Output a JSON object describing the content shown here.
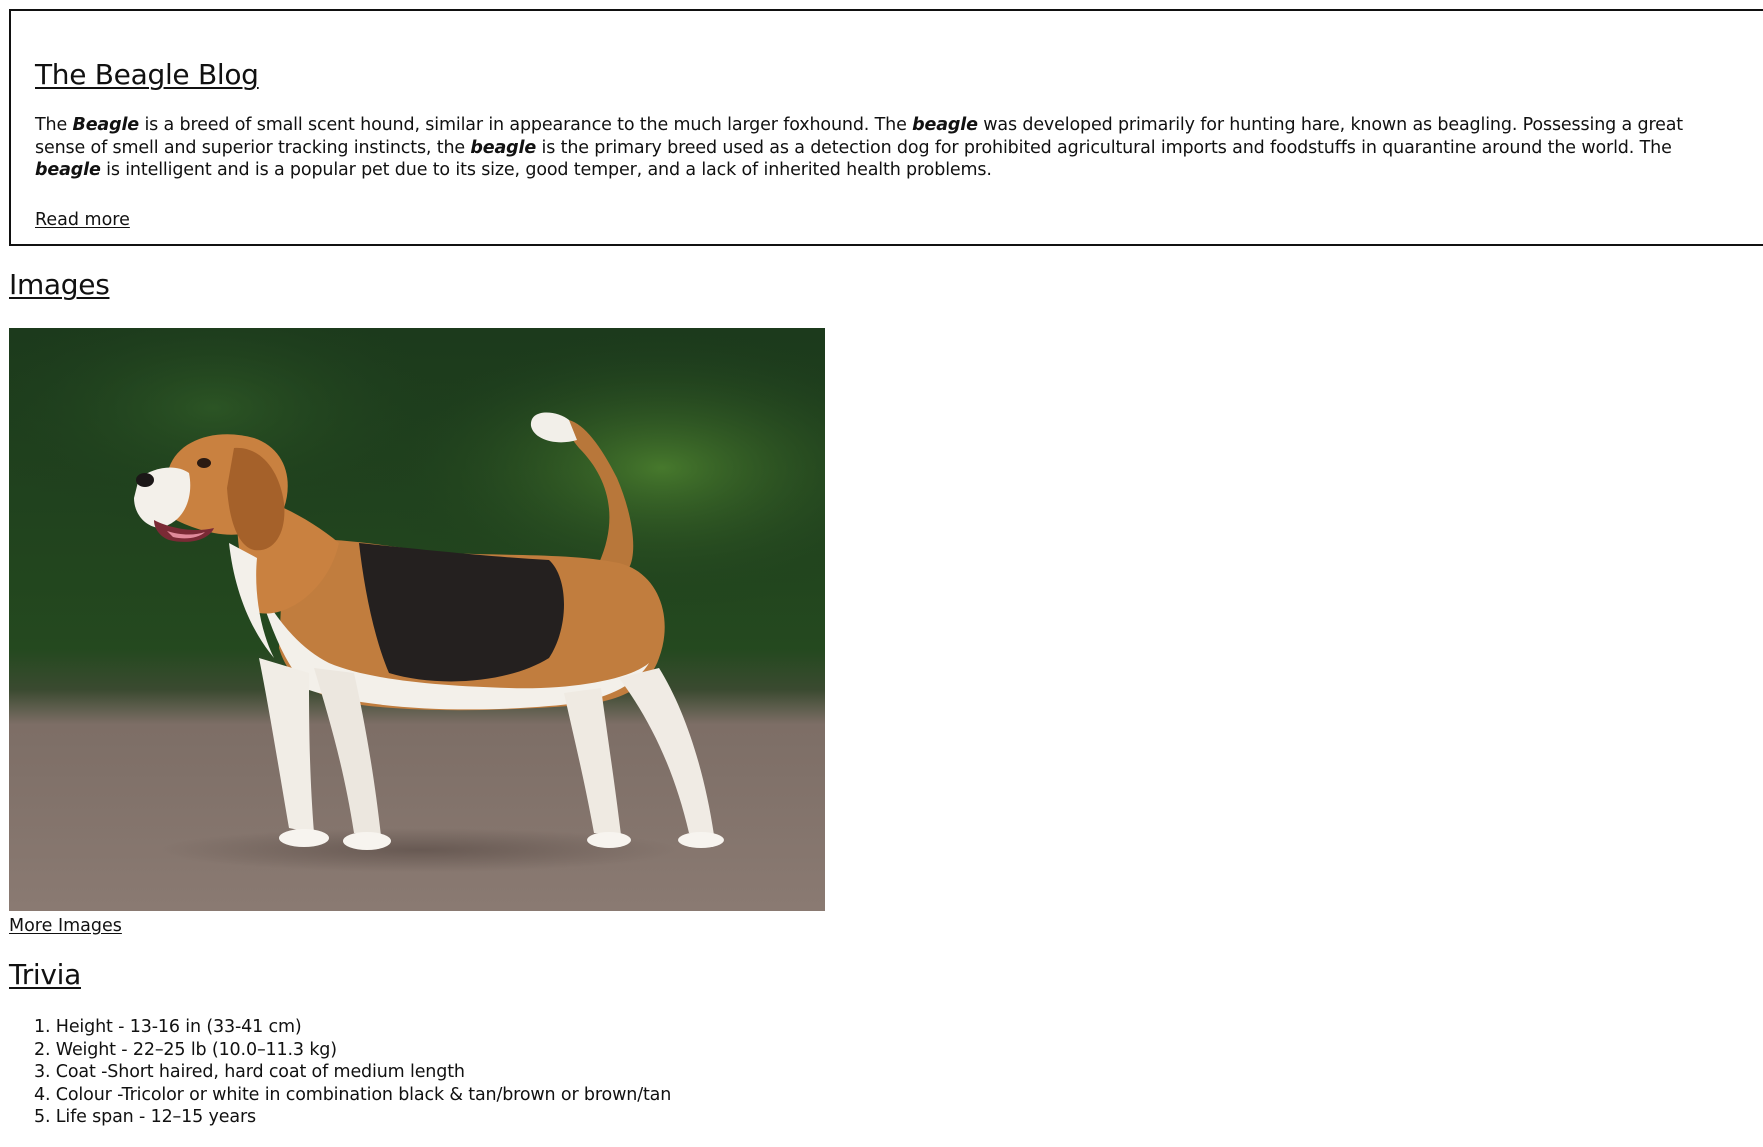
{
  "blog": {
    "title": "The Beagle Blog",
    "intro": [
      {
        "text": "The ",
        "emphasis": false
      },
      {
        "text": "Beagle",
        "emphasis": true
      },
      {
        "text": " is a breed of small scent hound, similar in appearance to the much larger foxhound. The ",
        "emphasis": false
      },
      {
        "text": "beagle",
        "emphasis": true
      },
      {
        "text": " was developed primarily for hunting hare, known as beagling. Possessing a great sense of smell and superior tracking instincts, the ",
        "emphasis": false
      },
      {
        "text": "beagle",
        "emphasis": true
      },
      {
        "text": " is the primary breed used as a detection dog for prohibited agricultural imports and foodstuffs in quarantine around the world. The ",
        "emphasis": false
      },
      {
        "text": "beagle",
        "emphasis": true
      },
      {
        "text": " is intelligent and is a popular pet due to its size, good temper, and a lack of inherited health problems.",
        "emphasis": false
      }
    ],
    "read_more_label": "Read more"
  },
  "images": {
    "heading": "Images",
    "more_images_label": "More Images"
  },
  "trivia": {
    "heading": "Trivia",
    "items": [
      "1. Height - 13-16 in (33-41 cm)",
      "2. Weight - 22–25 lb (10.0–11.3 kg)",
      "3. Coat -Short haired, hard coat of medium length",
      "4. Colour -Tricolor or white in combination black & tan/brown or brown/tan",
      "5. Life span - 12–15 years"
    ]
  },
  "colors": {
    "text": "#111111",
    "border": "#111111",
    "background": "#ffffff"
  }
}
